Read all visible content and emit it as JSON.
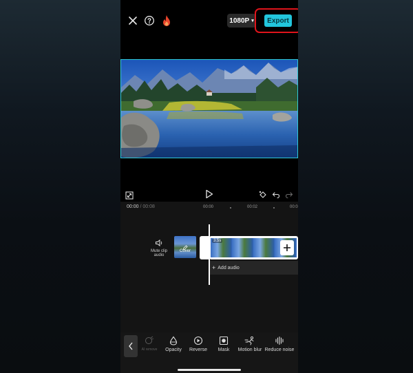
{
  "toolbar": {
    "resolution": "1080P",
    "export_label": "Export"
  },
  "timeline": {
    "current_time": "00:00",
    "separator": "/",
    "total_time": "00:08",
    "ticks": [
      "00:00",
      "00:02",
      "00:0"
    ],
    "mute_label_line1": "Mute clip",
    "mute_label_line2": "audio",
    "cover_label": "Cover",
    "clip_duration": "3.5s",
    "add_audio_label": "Add audio"
  },
  "bottom_bar": {
    "items": [
      {
        "label": "AI remove",
        "icon": "ai-remove-icon"
      },
      {
        "label": "Opacity",
        "icon": "opacity-icon"
      },
      {
        "label": "Reverse",
        "icon": "reverse-icon"
      },
      {
        "label": "Mask",
        "icon": "mask-icon"
      },
      {
        "label": "Motion blur",
        "icon": "motion-blur-icon"
      },
      {
        "label": "Reduce noise",
        "icon": "reduce-noise-icon"
      }
    ]
  },
  "colors": {
    "accent": "#22c6dd",
    "highlight": "#e0141b",
    "flame": "#e8452c"
  }
}
